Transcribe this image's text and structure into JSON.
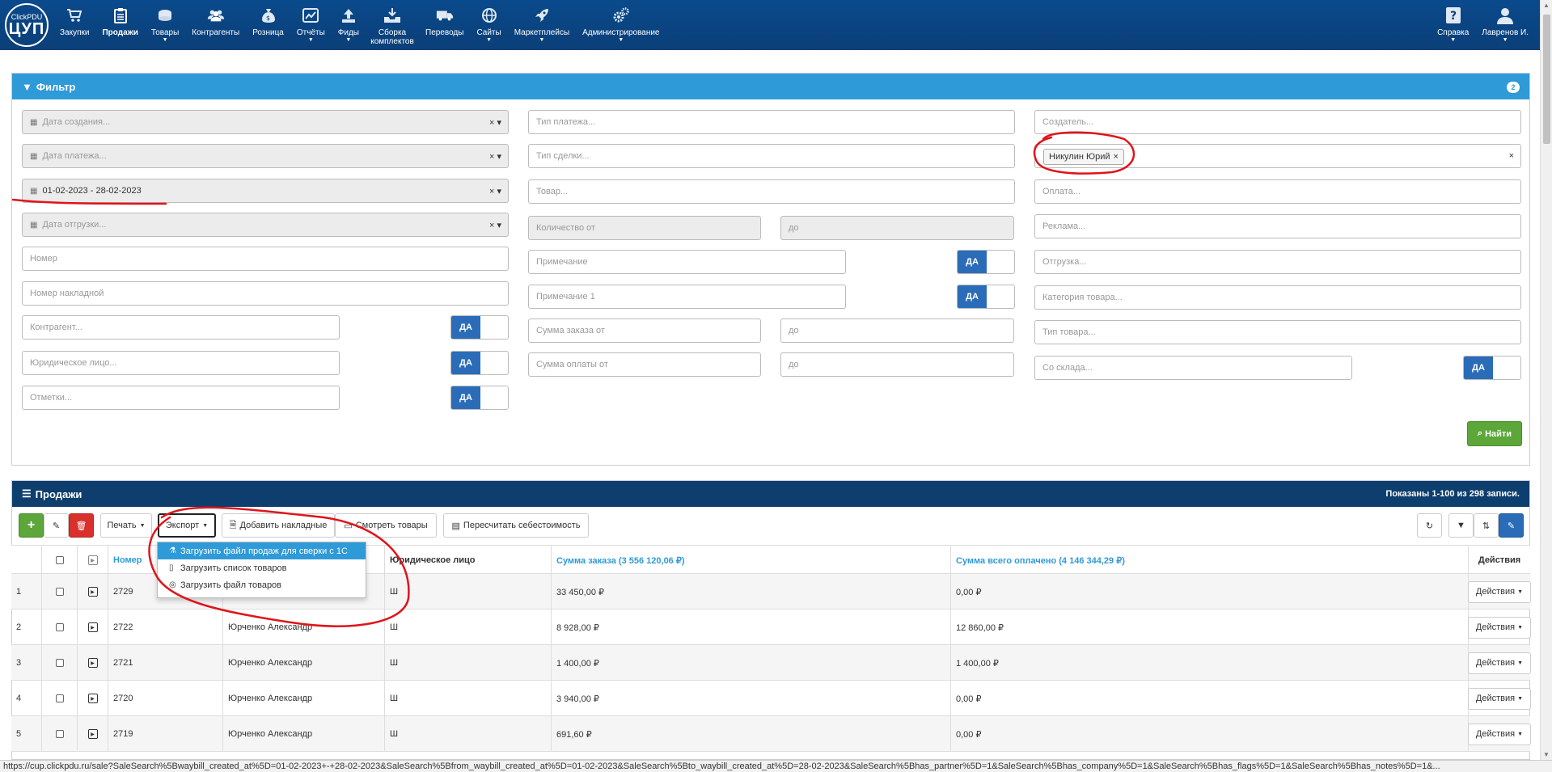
{
  "logo": {
    "small": "ClickPDU",
    "big": "ЦУП"
  },
  "nav": {
    "items": [
      {
        "label": "Закупки",
        "icon": "cart-icon",
        "caret": false
      },
      {
        "label": "Продажи",
        "icon": "clipboard-icon",
        "caret": false,
        "active": true
      },
      {
        "label": "Товары",
        "icon": "box-icon",
        "caret": true
      },
      {
        "label": "Контрагенты",
        "icon": "users-icon",
        "caret": false
      },
      {
        "label": "Розница",
        "icon": "money-bag-icon",
        "caret": false
      },
      {
        "label": "Отчёты",
        "icon": "chart-icon",
        "caret": true
      },
      {
        "label": "Фиды",
        "icon": "upload-icon",
        "caret": true
      },
      {
        "label": "Сборка комплектов",
        "icon": "tray-icon",
        "caret": false
      },
      {
        "label": "Переводы",
        "icon": "truck-icon",
        "caret": false
      },
      {
        "label": "Сайты",
        "icon": "globe-icon",
        "caret": true
      },
      {
        "label": "Маркетплейсы",
        "icon": "rocket-icon",
        "caret": true
      },
      {
        "label": "Администрирование",
        "icon": "gears-icon",
        "caret": true
      }
    ],
    "help": "Справка",
    "user": "Лавренов И."
  },
  "filter": {
    "title": "Фильтр",
    "badge": "2",
    "created_date": "Дата создания...",
    "payment_date": "Дата платежа...",
    "date_range": "01-02-2023 - 28-02-2023",
    "shipment_date": "Дата отгрузки...",
    "number": "Номер",
    "invoice_number": "Номер накладной",
    "counterparty": "Контрагент...",
    "legal_entity": "Юридическое лицо...",
    "marks": "Отметки...",
    "payment_type": "Тип платежа...",
    "deal_type": "Тип сделки...",
    "product": "Товар...",
    "qty_from": "Количество от",
    "qty_to": "до",
    "note": "Примечание",
    "note1": "Примечание 1",
    "order_sum_from": "Сумма заказа от",
    "order_sum_to": "до",
    "pay_sum_from": "Сумма оплаты от",
    "pay_sum_to": "до",
    "creator": "Создатель...",
    "creator_tag": "Никулин Юрий",
    "payment": "Оплата...",
    "ads": "Реклама...",
    "shipment": "Отгрузка...",
    "category": "Категория товара...",
    "product_type": "Тип товара...",
    "warehouse": "Со склада...",
    "yes": "ДА",
    "clear": "×",
    "find": "Найти"
  },
  "sales": {
    "title": "Продажи",
    "info": "Показаны 1-100 из 298 записи.",
    "toolbar": {
      "print": "Печать",
      "export": "Экспорт",
      "add_invoices": "Добавить накладные",
      "view_products": "Смотреть товары",
      "recalc": "Пересчитать себестоимость"
    },
    "export_menu": [
      "Загрузить файл продаж для сверки с 1С",
      "Загрузить список товаров",
      "Загрузить файл товаров"
    ],
    "columns": {
      "number": "Номер",
      "legal": "Юридическое лицо",
      "order_sum": "Сумма заказа (3 556 120,06 ₽)",
      "paid_sum": "Сумма всего оплачено (4 146 344,29 ₽)",
      "actions": "Действия"
    },
    "rows": [
      {
        "idx": "1",
        "number": "2729",
        "partner": "",
        "legal": "Ш",
        "order_sum": "33 450,00 ₽",
        "paid": "0,00 ₽",
        "action": "Действия"
      },
      {
        "idx": "2",
        "number": "2722",
        "partner": "Юрченко Александр",
        "legal": "Ш",
        "order_sum": "8 928,00 ₽",
        "paid": "12 860,00 ₽",
        "action": "Действия"
      },
      {
        "idx": "3",
        "number": "2721",
        "partner": "Юрченко Александр",
        "legal": "Ш",
        "order_sum": "1 400,00 ₽",
        "paid": "1 400,00 ₽",
        "action": "Действия"
      },
      {
        "idx": "4",
        "number": "2720",
        "partner": "Юрченко Александр",
        "legal": "Ш",
        "order_sum": "3 940,00 ₽",
        "paid": "0,00 ₽",
        "action": "Действия"
      },
      {
        "idx": "5",
        "number": "2719",
        "partner": "Юрченко Александр",
        "legal": "Ш",
        "order_sum": "691,60 ₽",
        "paid": "0,00 ₽",
        "action": "Действия"
      }
    ]
  },
  "status_url": "https://cup.clickpdu.ru/sale?SaleSearch%5Bwaybill_created_at%5D=01-02-2023+-+28-02-2023&SaleSearch%5Bfrom_waybill_created_at%5D=01-02-2023&SaleSearch%5Bto_waybill_created_at%5D=28-02-2023&SaleSearch%5Bhas_partner%5D=1&SaleSearch%5Bhas_company%5D=1&SaleSearch%5Bhas_flags%5D=1&SaleSearch%5Bhas_notes%5D=1&...",
  "colors": {
    "nav": "#0b3f78",
    "filter_head": "#2e9ad8",
    "sales_head": "#0d3e6e",
    "toggle": "#2b6cb8",
    "annotation": "#e0141b"
  }
}
